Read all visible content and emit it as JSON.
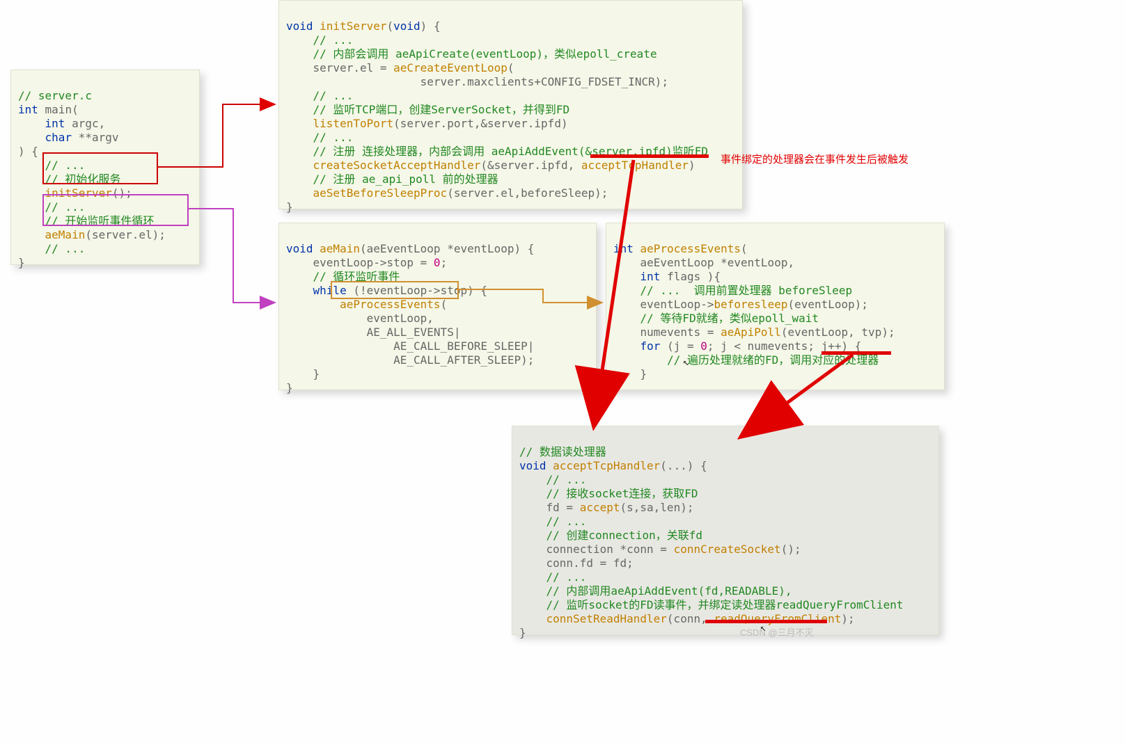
{
  "box_main": {
    "l1": "// server.c",
    "l2_a": "int",
    "l2_b": " main(",
    "l3_a": "    int",
    "l3_b": " argc,",
    "l4_a": "    char ",
    "l4_b": "**argv",
    "l5": ") {",
    "l6": "    // ...",
    "l7": "    // 初始化服务",
    "l8_a": "    ",
    "l8_b": "initServer",
    "l8_c": "();",
    "l9": "    // ...",
    "l10": "    // 开始监听事件循环",
    "l11_a": "    ",
    "l11_b": "aeMain",
    "l11_c": "(server.el);",
    "l12": "    // ...",
    "l13": "}"
  },
  "box_init": {
    "l1_a": "void",
    "l1_b": " initServer",
    "l1_c": "(",
    "l1_d": "void",
    "l1_e": ") {",
    "l2": "    // ...",
    "l3": "    // 内部会调用 aeApiCreate(eventLoop)，类似epoll_create",
    "l4_a": "    server.el = ",
    "l4_b": "aeCreateEventLoop",
    "l4_c": "(",
    "l5": "                    server.maxclients+CONFIG_FDSET_INCR);",
    "l6": "    // ...",
    "l7": "    // 监听TCP端口，创建ServerSocket，并得到FD",
    "l8_a": "    ",
    "l8_b": "listenToPort",
    "l8_c": "(server.port,&server.ipfd)",
    "l9": "    // ...",
    "l10": "    // 注册 连接处理器，内部会调用 aeApiAddEvent(&server.ipfd)监听FD",
    "l11_a": "    ",
    "l11_b": "createSocketAcceptHandler",
    "l11_c": "(&server.ipfd, ",
    "l11_d": "acceptTcpHandler",
    "l11_e": ")",
    "l12": "    // 注册 ae_api_poll 前的处理器",
    "l13_a": "    ",
    "l13_b": "aeSetBeforeSleepProc",
    "l13_c": "(server.el,beforeSleep);",
    "l14": "}"
  },
  "box_aemain": {
    "l1_a": "void",
    "l1_b": " aeMain",
    "l1_c": "(aeEventLoop *eventLoop) {",
    "l2_a": "    eventLoop->stop = ",
    "l2_b": "0",
    "l2_c": ";",
    "l3": "    // 循环监听事件",
    "l4_a": "    ",
    "l4_b": "while",
    "l4_c": " (!eventLoop->stop) {",
    "l5_a": "        ",
    "l5_b": "aeProcessEvents",
    "l5_c": "(",
    "l6": "            eventLoop,",
    "l7": "            AE_ALL_EVENTS|",
    "l8": "                AE_CALL_BEFORE_SLEEP|",
    "l9": "                AE_CALL_AFTER_SLEEP);",
    "l10": "    }",
    "l11": "}"
  },
  "box_proc": {
    "l1_a": "int",
    "l1_b": " aeProcessEvents",
    "l1_c": "(",
    "l2": "    aeEventLoop *eventLoop,",
    "l3_a": "    ",
    "l3_b": "int",
    "l3_c": " flags ){",
    "l4_a": "    // ...  ",
    "l4_b": "调用前置处理器 beforeSleep",
    "l5_a": "    eventLoop->",
    "l5_b": "beforesleep",
    "l5_c": "(eventLoop);",
    "l6": "    // 等待FD就绪，类似epoll_wait",
    "l7_a": "    numevents = ",
    "l7_b": "aeApiPoll",
    "l7_c": "(eventLoop, tvp);",
    "l8_a": "    ",
    "l8_b": "for",
    "l8_c": " (j = ",
    "l8_d": "0",
    "l8_e": "; j < numevents; j++) {",
    "l9": "        // 遍历处理就绪的FD，调用对应的处理器",
    "l10": "    }",
    "l11": "}"
  },
  "box_accept": {
    "l1": "// 数据读处理器",
    "l2_a": "void",
    "l2_b": " acceptTcpHandler",
    "l2_c": "(...) {",
    "l3": "    // ...",
    "l4": "    // 接收socket连接，获取FD",
    "l5_a": "    fd = ",
    "l5_b": "accept",
    "l5_c": "(s,sa,len);",
    "l6": "    // ...",
    "l7": "    // 创建connection，关联fd",
    "l8_a": "    connection *conn = ",
    "l8_b": "connCreateSocket",
    "l8_c": "();",
    "l9": "    conn.fd = fd;",
    "l10": "    // ...",
    "l11": "    // 内部调用aeApiAddEvent(fd,READABLE),",
    "l12": "    // 监听socket的FD读事件，并绑定读处理器readQueryFromClient",
    "l13_a": "    ",
    "l13_b": "connSetReadHandler",
    "l13_c": "(conn, ",
    "l13_d": "readQueryFromClient",
    "l13_e": ");",
    "l14": "}"
  },
  "annotation": "事件绑定的处理器会在事件发生后被触发",
  "watermark": "CSDN @三月不灭"
}
